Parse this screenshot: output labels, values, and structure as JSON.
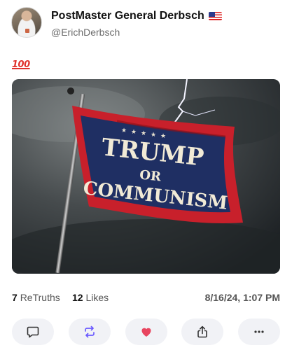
{
  "post": {
    "author": {
      "display_name": "PostMaster General Derbsch",
      "handle": "@ErichDerbsch",
      "badge_icon": "us-flag-icon"
    },
    "text_emoji": "100",
    "image": {
      "flag_text_line1": "TRUMP",
      "flag_text_line2": "OR",
      "flag_text_line3": "COMMUNISM"
    },
    "stats": {
      "retruths_count": "7",
      "retruths_label": "ReTruths",
      "likes_count": "12",
      "likes_label": "Likes",
      "timestamp": "8/16/24, 1:07 PM"
    },
    "actions": [
      {
        "name": "reply",
        "icon": "comment-icon"
      },
      {
        "name": "retruth",
        "icon": "retruth-icon"
      },
      {
        "name": "like",
        "icon": "heart-icon",
        "active": true
      },
      {
        "name": "share",
        "icon": "share-icon"
      },
      {
        "name": "more",
        "icon": "more-icon"
      }
    ],
    "colors": {
      "accent": "#6b5bff",
      "like_active": "#e8455f",
      "flag_blue": "#1f2f63",
      "flag_red": "#c8202b"
    }
  }
}
